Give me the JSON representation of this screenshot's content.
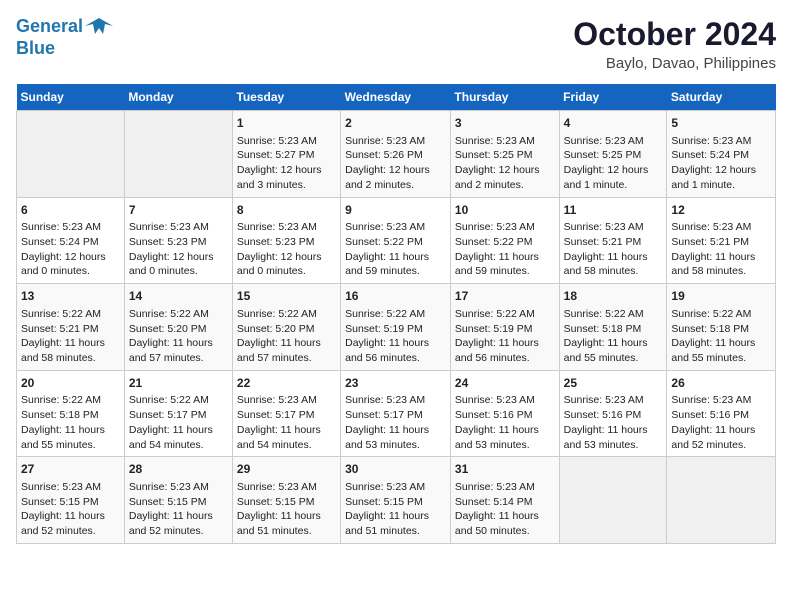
{
  "header": {
    "logo_line1": "General",
    "logo_line2": "Blue",
    "title": "October 2024",
    "subtitle": "Baylo, Davao, Philippines"
  },
  "calendar": {
    "weekdays": [
      "Sunday",
      "Monday",
      "Tuesday",
      "Wednesday",
      "Thursday",
      "Friday",
      "Saturday"
    ],
    "weeks": [
      [
        {
          "day": "",
          "info": ""
        },
        {
          "day": "",
          "info": ""
        },
        {
          "day": "1",
          "info": "Sunrise: 5:23 AM\nSunset: 5:27 PM\nDaylight: 12 hours\nand 3 minutes."
        },
        {
          "day": "2",
          "info": "Sunrise: 5:23 AM\nSunset: 5:26 PM\nDaylight: 12 hours\nand 2 minutes."
        },
        {
          "day": "3",
          "info": "Sunrise: 5:23 AM\nSunset: 5:25 PM\nDaylight: 12 hours\nand 2 minutes."
        },
        {
          "day": "4",
          "info": "Sunrise: 5:23 AM\nSunset: 5:25 PM\nDaylight: 12 hours\nand 1 minute."
        },
        {
          "day": "5",
          "info": "Sunrise: 5:23 AM\nSunset: 5:24 PM\nDaylight: 12 hours\nand 1 minute."
        }
      ],
      [
        {
          "day": "6",
          "info": "Sunrise: 5:23 AM\nSunset: 5:24 PM\nDaylight: 12 hours\nand 0 minutes."
        },
        {
          "day": "7",
          "info": "Sunrise: 5:23 AM\nSunset: 5:23 PM\nDaylight: 12 hours\nand 0 minutes."
        },
        {
          "day": "8",
          "info": "Sunrise: 5:23 AM\nSunset: 5:23 PM\nDaylight: 12 hours\nand 0 minutes."
        },
        {
          "day": "9",
          "info": "Sunrise: 5:23 AM\nSunset: 5:22 PM\nDaylight: 11 hours\nand 59 minutes."
        },
        {
          "day": "10",
          "info": "Sunrise: 5:23 AM\nSunset: 5:22 PM\nDaylight: 11 hours\nand 59 minutes."
        },
        {
          "day": "11",
          "info": "Sunrise: 5:23 AM\nSunset: 5:21 PM\nDaylight: 11 hours\nand 58 minutes."
        },
        {
          "day": "12",
          "info": "Sunrise: 5:23 AM\nSunset: 5:21 PM\nDaylight: 11 hours\nand 58 minutes."
        }
      ],
      [
        {
          "day": "13",
          "info": "Sunrise: 5:22 AM\nSunset: 5:21 PM\nDaylight: 11 hours\nand 58 minutes."
        },
        {
          "day": "14",
          "info": "Sunrise: 5:22 AM\nSunset: 5:20 PM\nDaylight: 11 hours\nand 57 minutes."
        },
        {
          "day": "15",
          "info": "Sunrise: 5:22 AM\nSunset: 5:20 PM\nDaylight: 11 hours\nand 57 minutes."
        },
        {
          "day": "16",
          "info": "Sunrise: 5:22 AM\nSunset: 5:19 PM\nDaylight: 11 hours\nand 56 minutes."
        },
        {
          "day": "17",
          "info": "Sunrise: 5:22 AM\nSunset: 5:19 PM\nDaylight: 11 hours\nand 56 minutes."
        },
        {
          "day": "18",
          "info": "Sunrise: 5:22 AM\nSunset: 5:18 PM\nDaylight: 11 hours\nand 55 minutes."
        },
        {
          "day": "19",
          "info": "Sunrise: 5:22 AM\nSunset: 5:18 PM\nDaylight: 11 hours\nand 55 minutes."
        }
      ],
      [
        {
          "day": "20",
          "info": "Sunrise: 5:22 AM\nSunset: 5:18 PM\nDaylight: 11 hours\nand 55 minutes."
        },
        {
          "day": "21",
          "info": "Sunrise: 5:22 AM\nSunset: 5:17 PM\nDaylight: 11 hours\nand 54 minutes."
        },
        {
          "day": "22",
          "info": "Sunrise: 5:23 AM\nSunset: 5:17 PM\nDaylight: 11 hours\nand 54 minutes."
        },
        {
          "day": "23",
          "info": "Sunrise: 5:23 AM\nSunset: 5:17 PM\nDaylight: 11 hours\nand 53 minutes."
        },
        {
          "day": "24",
          "info": "Sunrise: 5:23 AM\nSunset: 5:16 PM\nDaylight: 11 hours\nand 53 minutes."
        },
        {
          "day": "25",
          "info": "Sunrise: 5:23 AM\nSunset: 5:16 PM\nDaylight: 11 hours\nand 53 minutes."
        },
        {
          "day": "26",
          "info": "Sunrise: 5:23 AM\nSunset: 5:16 PM\nDaylight: 11 hours\nand 52 minutes."
        }
      ],
      [
        {
          "day": "27",
          "info": "Sunrise: 5:23 AM\nSunset: 5:15 PM\nDaylight: 11 hours\nand 52 minutes."
        },
        {
          "day": "28",
          "info": "Sunrise: 5:23 AM\nSunset: 5:15 PM\nDaylight: 11 hours\nand 52 minutes."
        },
        {
          "day": "29",
          "info": "Sunrise: 5:23 AM\nSunset: 5:15 PM\nDaylight: 11 hours\nand 51 minutes."
        },
        {
          "day": "30",
          "info": "Sunrise: 5:23 AM\nSunset: 5:15 PM\nDaylight: 11 hours\nand 51 minutes."
        },
        {
          "day": "31",
          "info": "Sunrise: 5:23 AM\nSunset: 5:14 PM\nDaylight: 11 hours\nand 50 minutes."
        },
        {
          "day": "",
          "info": ""
        },
        {
          "day": "",
          "info": ""
        }
      ]
    ]
  }
}
